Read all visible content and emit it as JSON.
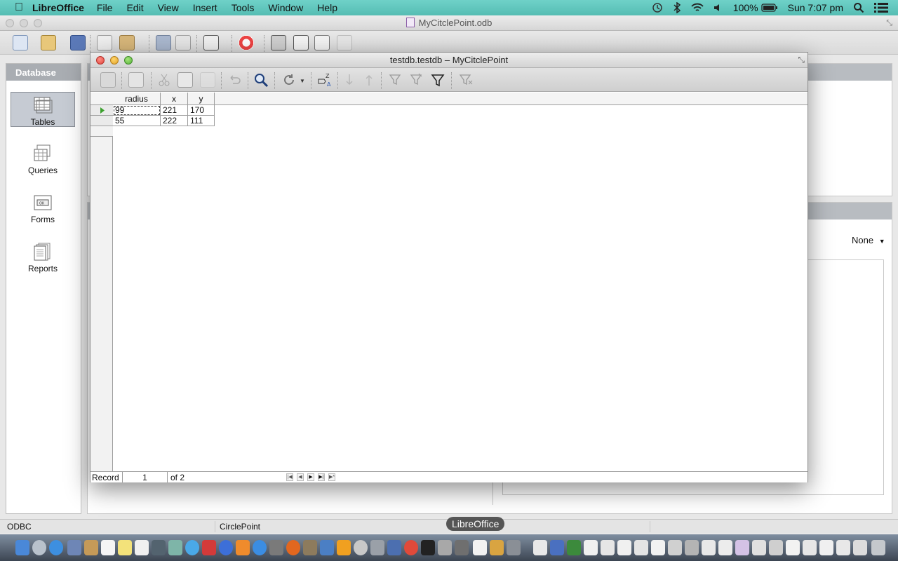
{
  "menubar": {
    "app_name": "LibreOffice",
    "menus": [
      "File",
      "Edit",
      "View",
      "Insert",
      "Tools",
      "Window",
      "Help"
    ],
    "battery": "100%",
    "clock": "Sun 7:07 pm"
  },
  "main_window": {
    "title": "MyCitclePoint.odb"
  },
  "database_panel": {
    "header": "Database",
    "items": [
      {
        "label": "Tables",
        "selected": true
      },
      {
        "label": "Queries",
        "selected": false
      },
      {
        "label": "Forms",
        "selected": false
      },
      {
        "label": "Reports",
        "selected": false
      }
    ]
  },
  "preview": {
    "selected_option": "None"
  },
  "statusbar": {
    "connection": "ODBC",
    "table_name": "CirclePoint"
  },
  "table_window": {
    "title": "testdb.testdb – MyCitclePoint",
    "columns": [
      "radius",
      "x",
      "y"
    ],
    "rows": [
      [
        "99",
        "221",
        "170"
      ],
      [
        "55",
        "222",
        "111"
      ]
    ],
    "nav": {
      "record_label": "Record",
      "current": "1",
      "of_total": "of 2"
    }
  },
  "dock": {
    "tooltip": "LibreOffice"
  },
  "colors": {
    "menubar": "#5cc4ba",
    "selection": "#c6cbd3",
    "close": "#e0443b",
    "minimize": "#e3a52b",
    "zoom": "#56b33a"
  }
}
